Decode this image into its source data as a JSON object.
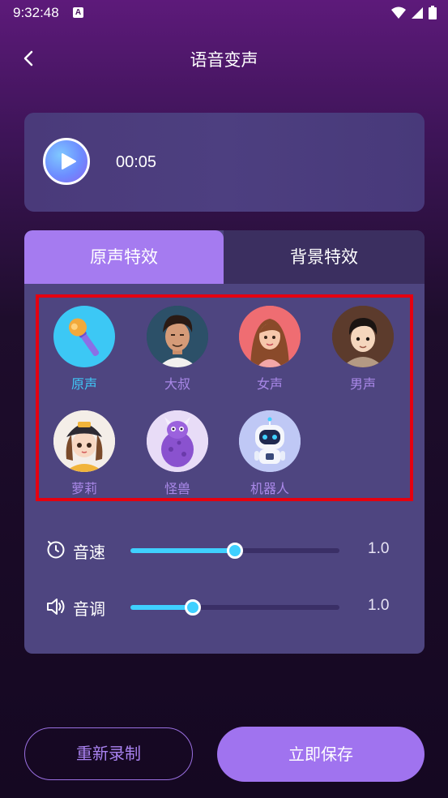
{
  "status_bar": {
    "time": "9:32:48",
    "notification_letter": "A"
  },
  "header": {
    "title": "语音变声"
  },
  "player": {
    "time": "00:05"
  },
  "tabs": [
    {
      "label": "原声特效",
      "active": true
    },
    {
      "label": "背景特效",
      "active": false
    }
  ],
  "effects": [
    {
      "label": "原声",
      "icon": "microphone-icon",
      "selected": true
    },
    {
      "label": "大叔",
      "icon": "uncle-avatar",
      "selected": false
    },
    {
      "label": "女声",
      "icon": "female-avatar",
      "selected": false
    },
    {
      "label": "男声",
      "icon": "male-avatar",
      "selected": false
    },
    {
      "label": "萝莉",
      "icon": "girl-avatar",
      "selected": false
    },
    {
      "label": "怪兽",
      "icon": "monster-avatar",
      "selected": false
    },
    {
      "label": "机器人",
      "icon": "robot-avatar",
      "selected": false
    }
  ],
  "sliders": {
    "speed": {
      "label": "音速",
      "value_text": "1.0",
      "fill_fraction": 0.5
    },
    "pitch": {
      "label": "音调",
      "value_text": "1.0",
      "fill_fraction": 0.3
    }
  },
  "buttons": {
    "redo": "重新录制",
    "save": "立即保存"
  },
  "colors": {
    "accent": "#a57bf0",
    "highlight": "#3fc7f6",
    "selection_border": "#e50010"
  }
}
